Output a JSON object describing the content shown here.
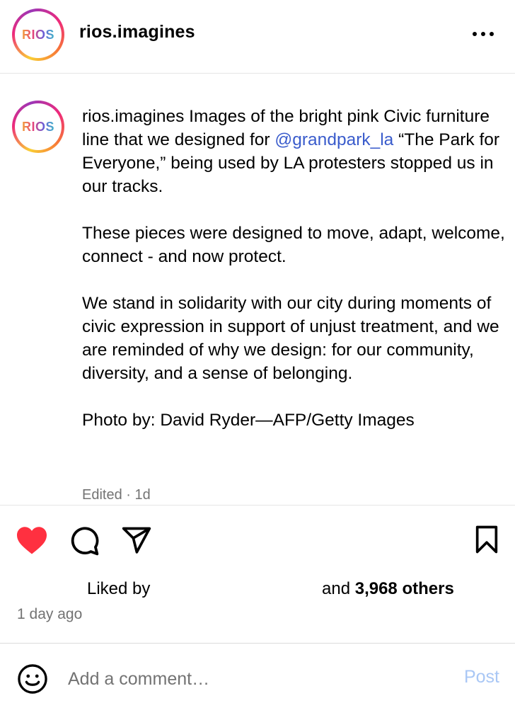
{
  "header": {
    "username": "rios.imagines",
    "avatar_text": "RIOS"
  },
  "caption": {
    "avatar_text": "RIOS",
    "username": "rios.imagines",
    "para1_text": "Images of the bright pink Civic furniture line that we designed for",
    "mention": "@grandpark_la",
    "para1_rest": "“The Park for Everyone,” being used by LA protesters stopped us in our tracks.",
    "para2": "These pieces were designed to move, adapt, welcome, connect - and now protect.",
    "para3": "We stand in solidarity with our city during moments of civic expression in support of unjust treatment, and we are reminded of why we design: for our community, diversity, and a sense of belonging.",
    "para4": "Photo by: David Ryder—AFP/Getty Images",
    "edited": "Edited · 1d"
  },
  "actions": {
    "heart_color": "#ff3040",
    "icons": [
      "heart-icon",
      "comment-icon",
      "share-icon",
      "bookmark-icon"
    ]
  },
  "likes": {
    "liked_by": "Liked by",
    "and": "and",
    "count": "3,968 others"
  },
  "timestamp": "1 day ago",
  "comment": {
    "placeholder": "Add a comment…",
    "post_label": "Post",
    "post_color": "#a9c7f5"
  }
}
